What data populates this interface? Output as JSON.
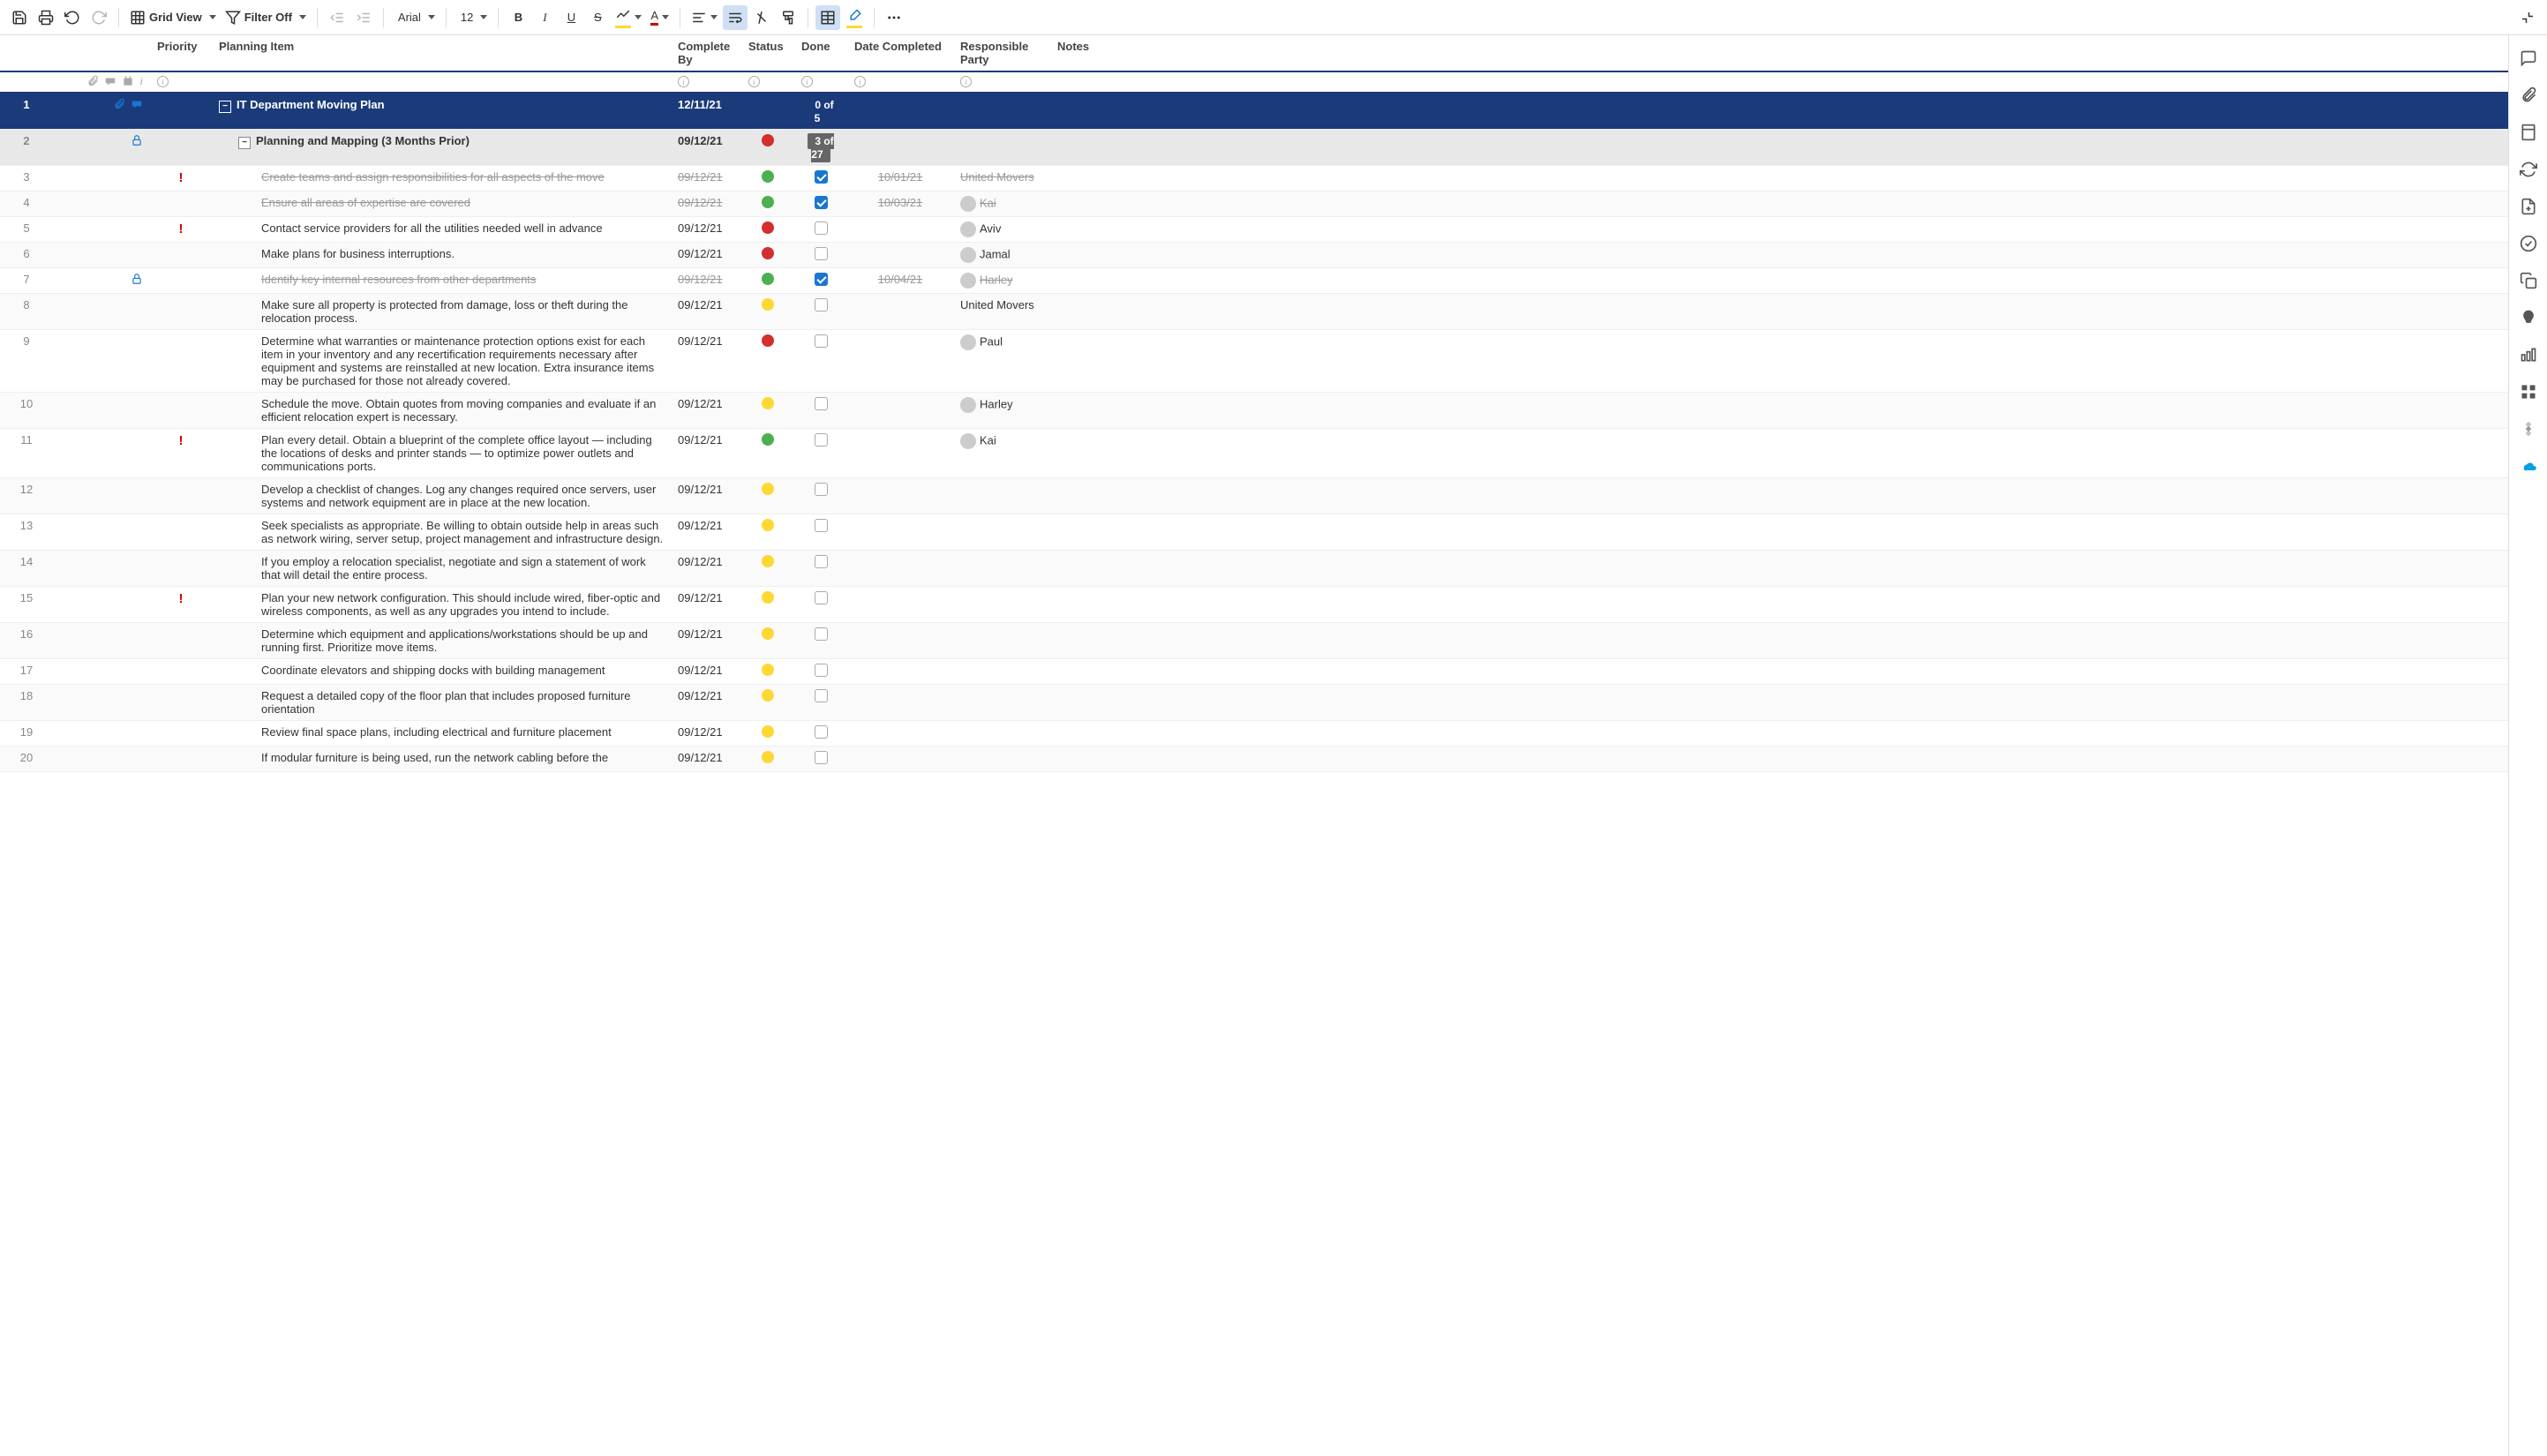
{
  "toolbar": {
    "grid_view": "Grid View",
    "filter_off": "Filter Off",
    "font": "Arial",
    "font_size": "12"
  },
  "columns": {
    "priority": "Priority",
    "planning_item": "Planning Item",
    "complete_by": "Complete By",
    "status": "Status",
    "done": "Done",
    "date_completed": "Date Completed",
    "responsible_party": "Responsible Party",
    "notes": "Notes"
  },
  "rows": [
    {
      "num": "1",
      "type": "primary",
      "item": "IT Department Moving Plan",
      "complete_by": "12/11/21",
      "done_badge": "0 of 5",
      "icons": [
        "attach",
        "comment"
      ]
    },
    {
      "num": "2",
      "type": "section",
      "item": "Planning and Mapping (3 Months Prior)",
      "complete_by": "09/12/21",
      "status": "red",
      "done_badge": "3 of 27",
      "icons": [
        "lock"
      ]
    },
    {
      "num": "3",
      "type": "task",
      "priority": true,
      "item": "Create teams and assign responsibilities for all aspects of the move",
      "complete_by": "09/12/21",
      "status": "green",
      "done": true,
      "date_completed": "10/01/21",
      "party": "United Movers",
      "avatar": false,
      "strike": true
    },
    {
      "num": "4",
      "type": "task",
      "item": "Ensure all areas of expertise are covered",
      "complete_by": "09/12/21",
      "status": "green",
      "done": true,
      "date_completed": "10/03/21",
      "party": "Kai",
      "avatar": true,
      "strike": true
    },
    {
      "num": "5",
      "type": "task",
      "priority": true,
      "item": "Contact service providers for all the utilities needed well in advance",
      "complete_by": "09/12/21",
      "status": "red",
      "done": false,
      "party": "Aviv",
      "avatar": true
    },
    {
      "num": "6",
      "type": "task",
      "item": "Make plans for business interruptions.",
      "complete_by": "09/12/21",
      "status": "red",
      "done": false,
      "party": "Jamal",
      "avatar": true
    },
    {
      "num": "7",
      "type": "task",
      "item": "Identify key internal resources from other departments",
      "complete_by": "09/12/21",
      "status": "green",
      "done": true,
      "date_completed": "10/04/21",
      "party": "Harley",
      "avatar": true,
      "strike": true,
      "icons": [
        "lock"
      ]
    },
    {
      "num": "8",
      "type": "task",
      "item": "Make sure all property is protected from damage, loss or theft during the relocation process.",
      "complete_by": "09/12/21",
      "status": "yellow",
      "done": false,
      "party": "United Movers",
      "avatar": false
    },
    {
      "num": "9",
      "type": "task",
      "item": "Determine what warranties or maintenance protection options exist for each item in your inventory and any recertification requirements necessary after equipment and systems are reinstalled at new location. Extra insurance items may be purchased for those not already covered.",
      "complete_by": "09/12/21",
      "status": "red",
      "done": false,
      "party": "Paul",
      "avatar": true
    },
    {
      "num": "10",
      "type": "task",
      "item": "Schedule the move. Obtain quotes from moving companies and evaluate if an efficient relocation expert is necessary.",
      "complete_by": "09/12/21",
      "status": "yellow",
      "done": false,
      "party": "Harley",
      "avatar": true
    },
    {
      "num": "11",
      "type": "task",
      "priority": true,
      "item": "Plan every detail. Obtain a blueprint of the complete office layout — including the locations of desks and printer stands — to optimize power outlets and communications ports.",
      "complete_by": "09/12/21",
      "status": "green",
      "done": false,
      "party": "Kai",
      "avatar": true
    },
    {
      "num": "12",
      "type": "task",
      "item": "Develop a checklist of changes. Log any changes required once servers, user systems and network equipment are in place at the new location.",
      "complete_by": "09/12/21",
      "status": "yellow",
      "done": false
    },
    {
      "num": "13",
      "type": "task",
      "item": "Seek specialists as appropriate. Be willing to obtain outside help in areas such as network wiring, server setup, project management and infrastructure design.",
      "complete_by": "09/12/21",
      "status": "yellow",
      "done": false
    },
    {
      "num": "14",
      "type": "task",
      "item": "If you employ a relocation specialist, negotiate and sign a statement of work that will detail the entire process.",
      "complete_by": "09/12/21",
      "status": "yellow",
      "done": false
    },
    {
      "num": "15",
      "type": "task",
      "priority": true,
      "item": "Plan your new network configuration. This should include wired, fiber-optic and wireless components, as well as any upgrades you intend to include.",
      "complete_by": "09/12/21",
      "status": "yellow",
      "done": false
    },
    {
      "num": "16",
      "type": "task",
      "item": "Determine which equipment and applications/workstations should be up and running first. Prioritize move items.",
      "complete_by": "09/12/21",
      "status": "yellow",
      "done": false
    },
    {
      "num": "17",
      "type": "task",
      "item": "Coordinate elevators and shipping docks with building management",
      "complete_by": "09/12/21",
      "status": "yellow",
      "done": false
    },
    {
      "num": "18",
      "type": "task",
      "item": "Request a detailed copy of the floor plan that includes proposed furniture orientation",
      "complete_by": "09/12/21",
      "status": "yellow",
      "done": false
    },
    {
      "num": "19",
      "type": "task",
      "item": "Review final space plans, including electrical and furniture placement",
      "complete_by": "09/12/21",
      "status": "yellow",
      "done": false
    },
    {
      "num": "20",
      "type": "task",
      "item": "If modular furniture is being used, run the network cabling before the",
      "complete_by": "09/12/21",
      "status": "yellow",
      "done": false
    }
  ]
}
